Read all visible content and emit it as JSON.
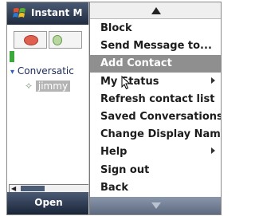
{
  "window": {
    "title": "Instant M"
  },
  "conversations": {
    "header": "Conversatic",
    "contact": "jimmy"
  },
  "softkeys": {
    "left": "Open"
  },
  "menu": {
    "items": [
      {
        "label": "Block",
        "submenu": false,
        "selected": false
      },
      {
        "label": "Send Message to...",
        "submenu": false,
        "selected": false
      },
      {
        "label": "Add Contact",
        "submenu": false,
        "selected": true
      },
      {
        "label": "My Status",
        "submenu": true,
        "selected": false
      },
      {
        "label": "Refresh contact list",
        "submenu": false,
        "selected": false
      },
      {
        "label": "Saved Conversations",
        "submenu": false,
        "selected": false
      },
      {
        "label": "Change Display Name",
        "submenu": false,
        "selected": false
      },
      {
        "label": "Help",
        "submenu": true,
        "selected": false
      },
      {
        "label": "Sign out",
        "submenu": false,
        "selected": false
      },
      {
        "label": "Back",
        "submenu": false,
        "selected": false
      }
    ]
  },
  "colors": {
    "titlebar": "#2f3b52",
    "selection": "#8f8f8f",
    "status_green": "#3aa83a"
  },
  "icons": {
    "start": "windows-start-icon",
    "scroll_up": "triangle-up-icon",
    "scroll_down": "triangle-down-icon"
  }
}
